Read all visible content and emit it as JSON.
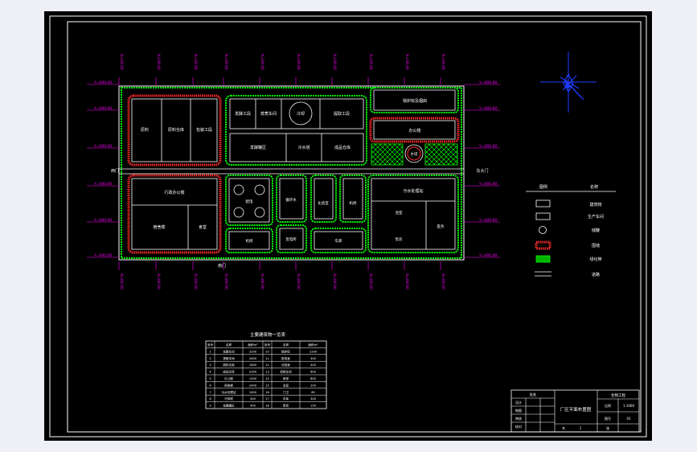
{
  "colors": {
    "background": "#eef0f6",
    "sheet": "#000000",
    "frame": "#ffffff",
    "dimension": "#ff00ff",
    "road": "#ffffff",
    "greenbelt": "#00ff00",
    "wall": "#ff2a2a",
    "compass": "#1e3cff",
    "table_line": "#ffffff"
  },
  "icons": {
    "north_arrow": "compass-north-arrow-icon"
  },
  "gates": {
    "west": "西门",
    "east": "东大门",
    "south": "南门"
  },
  "coords": {
    "top": [
      "X=00.00",
      "X=00.00",
      "X=00.00",
      "X=00.00",
      "X=00.00",
      "X=00.00",
      "X=00.00",
      "X=00.00",
      "X=00.00",
      "X=00.00"
    ],
    "bottom": [
      "X=00.00",
      "X=00.00",
      "X=00.00",
      "X=00.00",
      "X=00.00",
      "X=00.00",
      "X=00.00",
      "X=00.00",
      "X=00.00",
      "X=00.00"
    ],
    "left": [
      "Y=000.00",
      "Y=000.00",
      "Y=000.00",
      "Y=000.00",
      "Y=000.00",
      "Y=000.00"
    ],
    "right": [
      "Y=000.00",
      "Y=000.00",
      "Y=000.00",
      "Y=000.00",
      "Y=000.00",
      "Y=000.00"
    ]
  },
  "buildings": {
    "b1": "原料",
    "b2": "原料仓库",
    "b3": "包装工段",
    "b4": "发酵工段",
    "b5": "蒸煮车间",
    "b6": "冷却",
    "b7": "提取工段",
    "b8": "锅炉房及烟囱",
    "b9": "办公楼",
    "b10": "发酵罐区",
    "b11": "冷水塔",
    "b12": "成品仓库",
    "b13": "行政办公楼",
    "b14": "食堂",
    "b15": "宿舍楼",
    "b16": "污水处理站",
    "b17": "机修",
    "b18": "变电所",
    "b19": "配电",
    "b20": "循环水",
    "b21": "化验室",
    "b22": "机修",
    "b23": "工具",
    "b24": "车库",
    "b25": "浴室",
    "b26": "医务",
    "b27": "泵房",
    "b28": "水塔",
    "b29": "门卫",
    "b30": "消防"
  },
  "legend": {
    "head_symbol": "图例",
    "head_name": "名称",
    "items": [
      "建筑物",
      "生产车间",
      "储罐",
      "围墙",
      "绿化带",
      "道路"
    ]
  },
  "table": {
    "title": "主要建筑物一览表",
    "headers": [
      "序号",
      "名称",
      "面积m²",
      "序号",
      "名称",
      "面积m²"
    ],
    "rows": [
      [
        "1",
        "发酵车间",
        "3200",
        "10",
        "锅炉房",
        "1200"
      ],
      [
        "2",
        "提取车间",
        "2600",
        "11",
        "配电室",
        "300"
      ],
      [
        "3",
        "原料仓库",
        "1800",
        "12",
        "化验室",
        "400"
      ],
      [
        "4",
        "成品仓库",
        "2000",
        "13",
        "机修车间",
        "600"
      ],
      [
        "5",
        "办公楼",
        "1500",
        "14",
        "食堂",
        "800"
      ],
      [
        "6",
        "宿舍楼",
        "2400",
        "15",
        "浴室",
        "200"
      ],
      [
        "7",
        "污水处理站",
        "1600",
        "16",
        "门卫",
        "60"
      ],
      [
        "8",
        "冷却塔",
        "400",
        "17",
        "车库",
        "300"
      ],
      [
        "9",
        "发酵罐区",
        "900",
        "18",
        "泵房",
        "150"
      ]
    ]
  },
  "titleblock": {
    "drawing_title": "厂区平面布置图",
    "labels": [
      "设计",
      "制图",
      "审核",
      "校对",
      "批准"
    ],
    "school": "生物工程",
    "scale_label": "比例",
    "scale": "1:1000",
    "sheet_label": "图号",
    "sheet": "01",
    "page_label": "共",
    "page": "1",
    "mark": "张"
  }
}
